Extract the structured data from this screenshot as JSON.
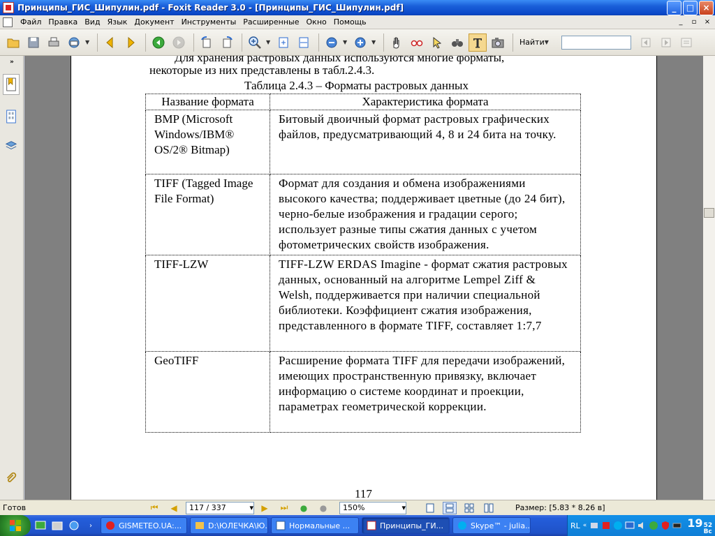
{
  "window": {
    "title": "Принципы_ГИС_Шипулин.pdf - Foxit Reader 3.0 - [Принципы_ГИС_Шипулин.pdf]",
    "buttons": {
      "minimize": "_",
      "maximize": "□",
      "close": "×"
    }
  },
  "menu": {
    "items": [
      "Файл",
      "Правка",
      "Вид",
      "Язык",
      "Документ",
      "Инструменты",
      "Расширенные",
      "Окно",
      "Помощь"
    ],
    "mdi_buttons": [
      "_",
      "▫",
      "×"
    ]
  },
  "toolbar": {
    "find_label": "Найти",
    "find_value": "",
    "icons": [
      "open-icon",
      "save-icon",
      "print-icon",
      "email-icon",
      "prev-page-icon",
      "next-page-icon",
      "back-icon",
      "forward-icon",
      "rotate-left-icon",
      "rotate-right-icon",
      "zoom-in-icon",
      "fit-page-icon",
      "fit-width-icon",
      "zoom-out-icon",
      "zoom-plus-icon",
      "hand-tool-icon",
      "glasses-icon",
      "select-icon",
      "binoculars-icon",
      "text-select-icon",
      "snapshot-icon",
      "find-prev-icon",
      "find-next-icon",
      "find-options-icon"
    ]
  },
  "document": {
    "para_cut": "Для хранения растровых данных используются многие форматы,",
    "para_line2": "некоторые из них представлены в табл.2.4.3.",
    "table_caption": "Таблица 2.4.3 – Форматы растровых данных",
    "table": {
      "headers": [
        "Название формата",
        "Характеристика формата"
      ],
      "rows": [
        {
          "name": "BMP (Microsoft Windows/IBM® OS/2® Bitmap)",
          "desc": "Битовый двоичный формат растровых графических файлов, предусматривающий 4, 8 и 24 бита на точку."
        },
        {
          "name": "TIFF (Tagged Image File Format)",
          "desc": "Формат для создания и обмена изображениями высокого качества; поддерживает цветные (до 24 бит), черно-белые изображения и градации серого; использует разные типы сжатия данных с учетом фотометрических свойств изображения."
        },
        {
          "name": "TIFF-LZW",
          "desc": "TIFF-LZW ERDAS Imagine - формат сжатия растровых данных, основанный на алгоритме Lempel Ziff & Welsh, поддерживается при наличии специальной библиотеки. Коэффициент сжатия изображения, представленного в формате TIFF, составляет 1:7,7"
        },
        {
          "name": "GeoTIFF",
          "desc": "Расширение формата TIFF для передачи изображений, имеющих пространственную привязку, включает информацию о системе координат и проекции, параметрах геометрической коррекции."
        }
      ]
    },
    "page_number": "117"
  },
  "statusbar": {
    "status": "Готов",
    "page_field": "117 / 337",
    "zoom": "150%",
    "size": "Размер: [5.83 * 8.26 в]"
  },
  "taskbar": {
    "tasks": [
      {
        "label": "GISMETEO.UA:...",
        "active": false
      },
      {
        "label": "D:\\ЮЛЕЧКА\\Ю...",
        "active": false
      },
      {
        "label": "Нормальные ...",
        "active": false
      },
      {
        "label": "Принципы_ГИ...",
        "active": true
      },
      {
        "label": "Skype™ - julia...",
        "active": false
      }
    ],
    "language": "RL",
    "clock_hour": "19",
    "clock_min": "52",
    "clock_day": "Вс"
  },
  "colors": {
    "title_bar": "#0a47c8",
    "doc_background": "#808080",
    "taskbar": "#245edb",
    "start": "#2d8a2a"
  }
}
